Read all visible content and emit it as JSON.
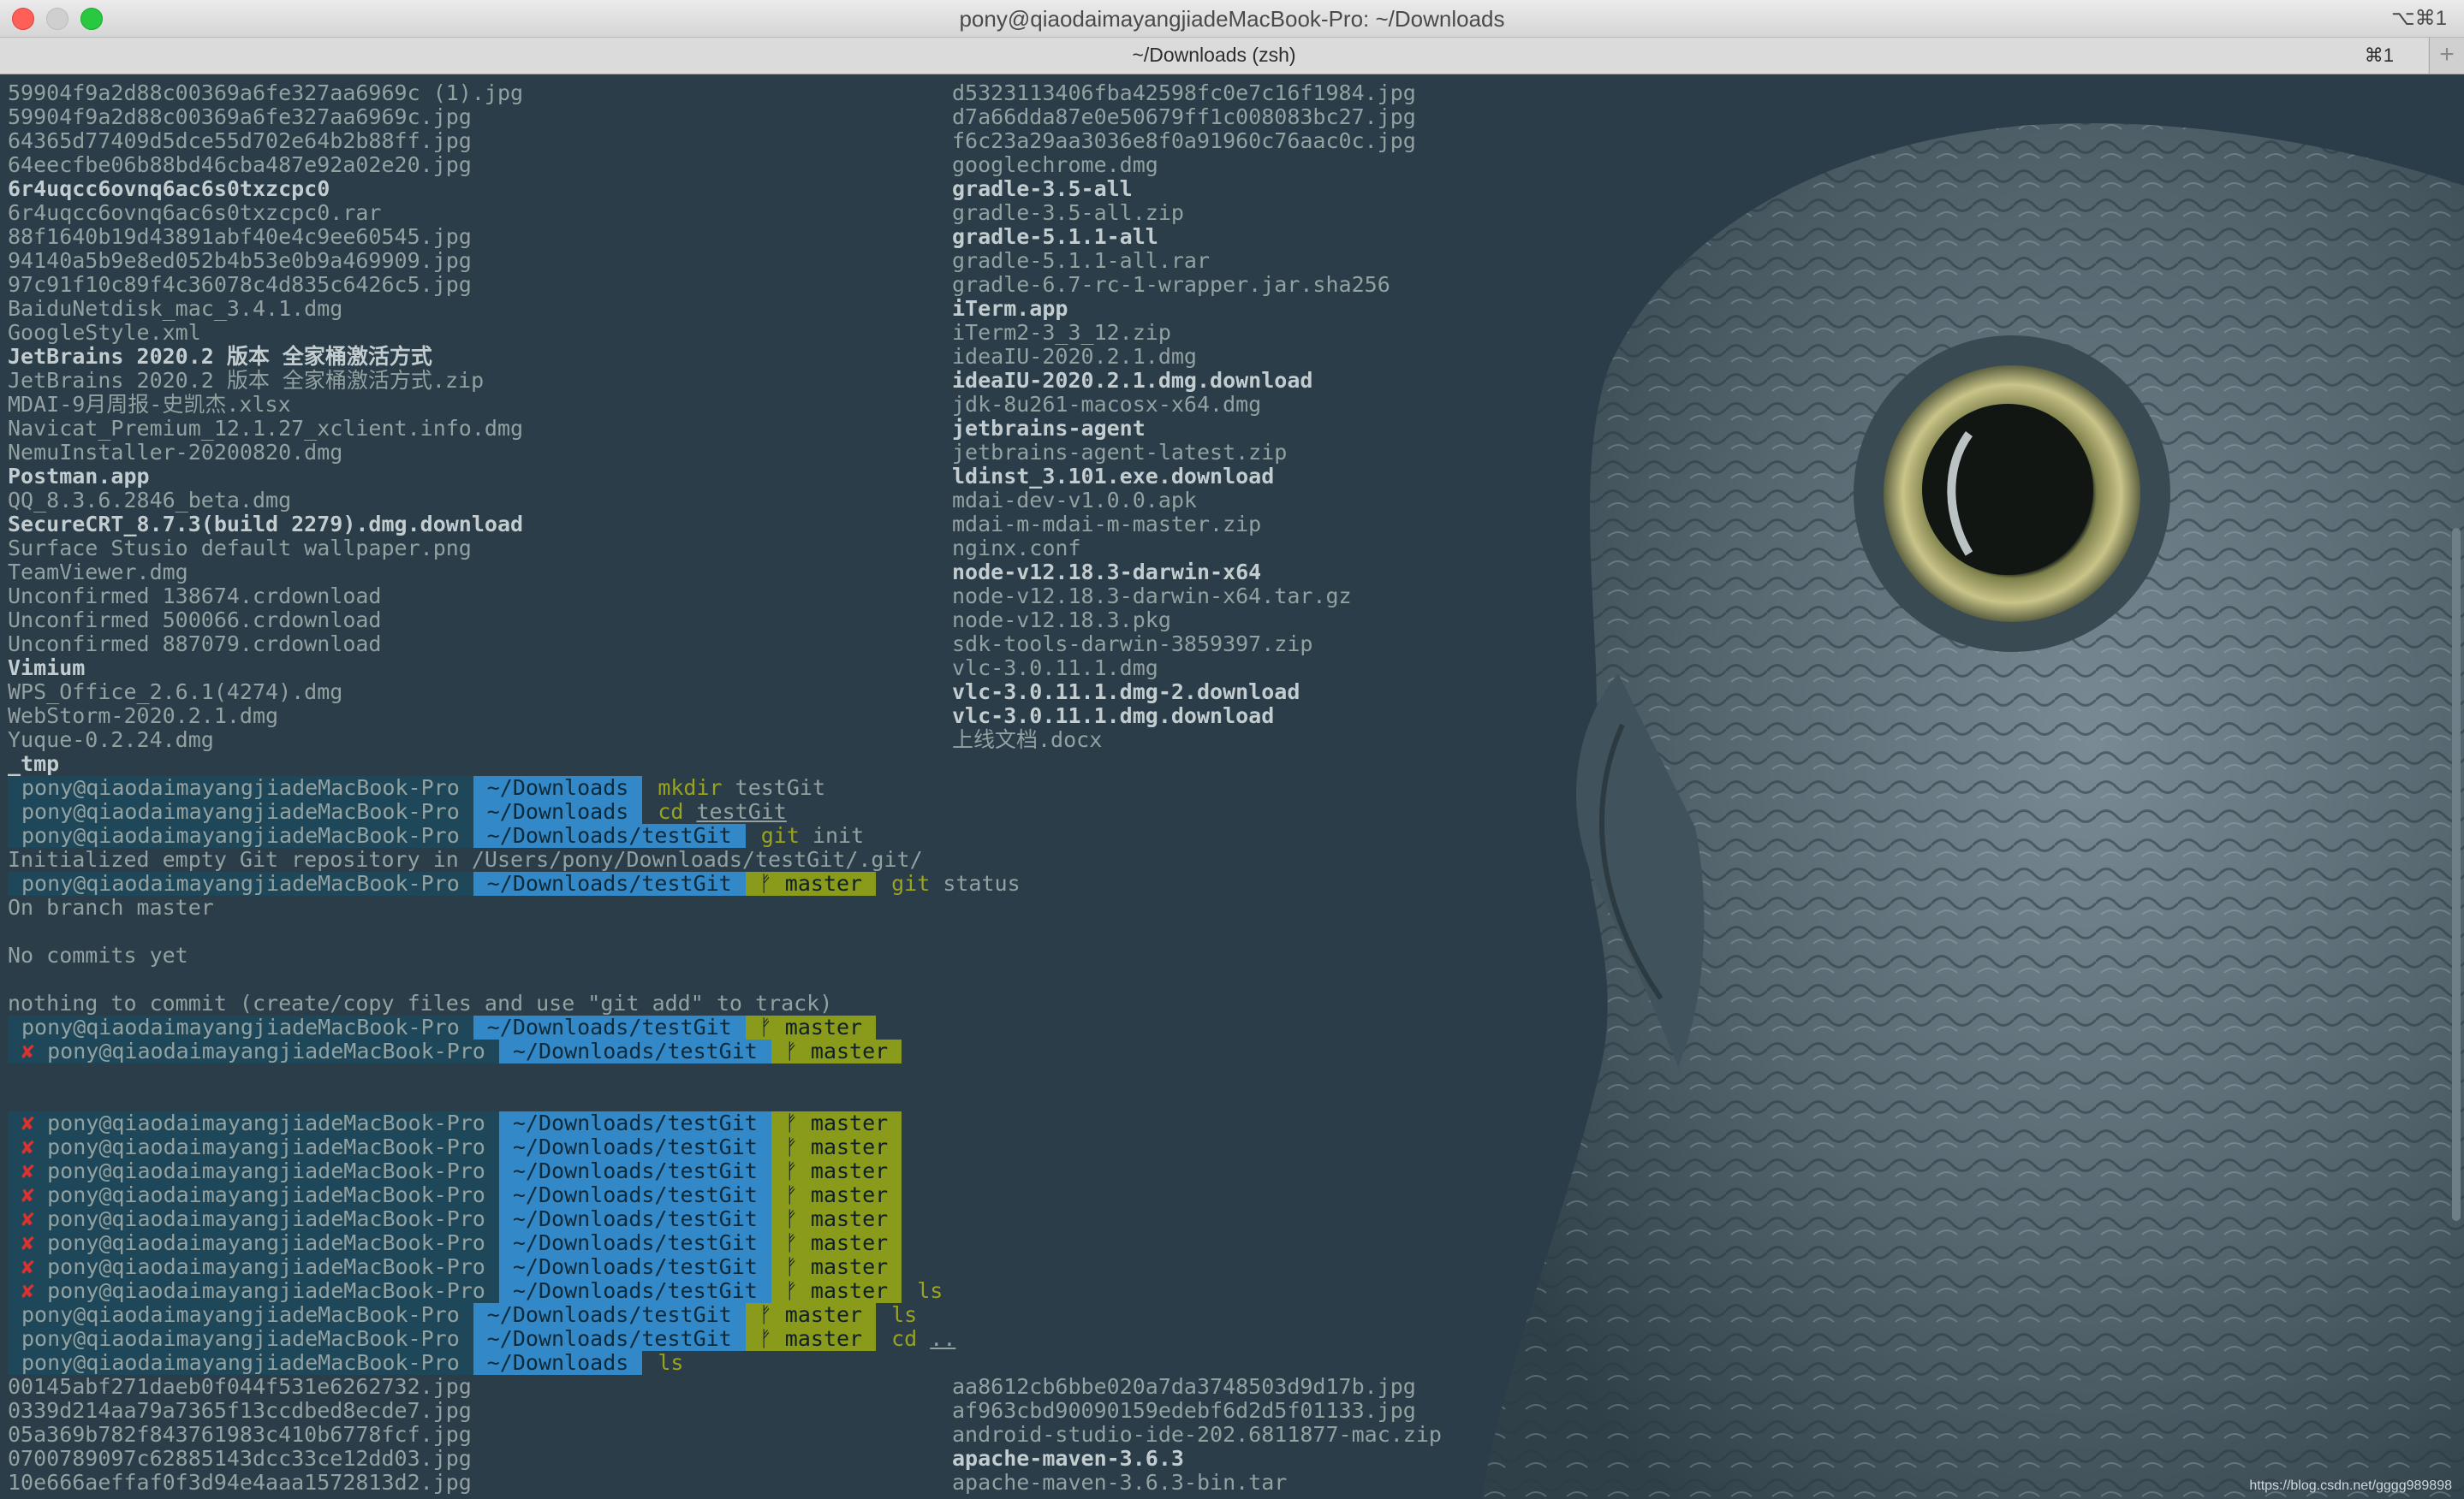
{
  "window": {
    "title": "pony@qiaodaimayangjiadeMacBook-Pro: ~/Downloads",
    "shortcut": "⌥⌘1",
    "tab_title": "~/Downloads (zsh)",
    "tab_shortcut": "⌘1",
    "new_tab": "+"
  },
  "theme": {
    "background": "#2a3d49",
    "text": "#93a1a1",
    "prompt_user_bg": "#1e4859",
    "prompt_dir_bg": "#3388c8",
    "prompt_git_bg": "#8a9a1a",
    "error_mark": "#dc322f"
  },
  "prompt": {
    "user": "pony@qiaodaimayangjiadeMacBook-Pro",
    "err_mark": "✘",
    "branch_icon": "ᚠ"
  },
  "terminal": {
    "listing1_col1": [
      "59904f9a2d88c00369a6fe327aa6969c (1).jpg",
      "59904f9a2d88c00369a6fe327aa6969c.jpg",
      "64365d77409d5dce55d702e64b2b88ff.jpg",
      "64eecfbe06b88bd46cba487e92a02e20.jpg",
      "6r4uqcc6ovnq6ac6s0txzcpc0",
      "6r4uqcc6ovnq6ac6s0txzcpc0.rar",
      "88f1640b19d43891abf40e4c9ee60545.jpg",
      "94140a5b9e8ed052b4b53e0b9a469909.jpg",
      "97c91f10c89f4c36078c4d835c6426c5.jpg",
      "BaiduNetdisk_mac_3.4.1.dmg",
      "GoogleStyle.xml",
      "JetBrains 2020.2 版本 全家桶激活方式",
      "JetBrains 2020.2 版本 全家桶激活方式.zip",
      "MDAI-9月周报-史凯杰.xlsx",
      "Navicat_Premium_12.1.27_xclient.info.dmg",
      "NemuInstaller-20200820.dmg",
      "Postman.app",
      "QQ_8.3.6.2846_beta.dmg",
      "SecureCRT_8.7.3(build 2279).dmg.download",
      "Surface Stusio default wallpaper.png",
      "TeamViewer.dmg",
      "Unconfirmed 138674.crdownload",
      "Unconfirmed 500066.crdownload",
      "Unconfirmed 887079.crdownload",
      "Vimium",
      "WPS_Office_2.6.1(4274).dmg",
      "WebStorm-2020.2.1.dmg",
      "Yuque-0.2.24.dmg",
      "_tmp"
    ],
    "listing1_col2": [
      "d5323113406fba42598fc0e7c16f1984.jpg",
      "d7a66dda87e0e50679ff1c008083bc27.jpg",
      "f6c23a29aa3036e8f0a91960c76aac0c.jpg",
      "googlechrome.dmg",
      "gradle-3.5-all",
      "gradle-3.5-all.zip",
      "gradle-5.1.1-all",
      "gradle-5.1.1-all.rar",
      "gradle-6.7-rc-1-wrapper.jar.sha256",
      "iTerm.app",
      "iTerm2-3_3_12.zip",
      "ideaIU-2020.2.1.dmg",
      "ideaIU-2020.2.1.dmg.download",
      "jdk-8u261-macosx-x64.dmg",
      "jetbrains-agent",
      "jetbrains-agent-latest.zip",
      "ldinst_3.101.exe.download",
      "mdai-dev-v1.0.0.apk",
      "mdai-m-mdai-m-master.zip",
      "nginx.conf",
      "node-v12.18.3-darwin-x64",
      "node-v12.18.3-darwin-x64.tar.gz",
      "node-v12.18.3.pkg",
      "sdk-tools-darwin-3859397.zip",
      "vlc-3.0.11.1.dmg",
      "vlc-3.0.11.1.dmg-2.download",
      "vlc-3.0.11.1.dmg.download",
      "上线文档.docx"
    ],
    "prompts": [
      {
        "err": false,
        "dir": "~/Downloads",
        "branch": "",
        "cmd": "mkdir",
        "arg": "testGit",
        "arg_under": false
      },
      {
        "err": false,
        "dir": "~/Downloads",
        "branch": "",
        "cmd": "cd",
        "arg": "testGit",
        "arg_under": true
      },
      {
        "err": false,
        "dir": "~/Downloads/testGit",
        "branch": "",
        "cmd": "git",
        "arg": "init",
        "arg_under": false
      },
      {
        "output": "Initialized empty Git repository in /Users/pony/Downloads/testGit/.git/"
      },
      {
        "err": false,
        "dir": "~/Downloads/testGit",
        "branch": "master",
        "cmd": "git",
        "arg": "status",
        "arg_under": false
      },
      {
        "output": "On branch master"
      },
      {
        "output": ""
      },
      {
        "output": "No commits yet"
      },
      {
        "output": ""
      },
      {
        "output": "nothing to commit (create/copy files and use \"git add\" to track)"
      },
      {
        "err": false,
        "dir": "~/Downloads/testGit",
        "branch": "master",
        "cmd": "",
        "arg": "",
        "arg_under": false
      },
      {
        "err": true,
        "dir": "~/Downloads/testGit",
        "branch": "master",
        "cmd": "",
        "arg": "",
        "arg_under": false
      },
      {
        "output": ""
      },
      {
        "output": ""
      },
      {
        "err": true,
        "dir": "~/Downloads/testGit",
        "branch": "master",
        "cmd": "",
        "arg": "",
        "arg_under": false
      },
      {
        "err": true,
        "dir": "~/Downloads/testGit",
        "branch": "master",
        "cmd": "",
        "arg": "",
        "arg_under": false
      },
      {
        "err": true,
        "dir": "~/Downloads/testGit",
        "branch": "master",
        "cmd": "",
        "arg": "",
        "arg_under": false
      },
      {
        "err": true,
        "dir": "~/Downloads/testGit",
        "branch": "master",
        "cmd": "",
        "arg": "",
        "arg_under": false
      },
      {
        "err": true,
        "dir": "~/Downloads/testGit",
        "branch": "master",
        "cmd": "",
        "arg": "",
        "arg_under": false
      },
      {
        "err": true,
        "dir": "~/Downloads/testGit",
        "branch": "master",
        "cmd": "",
        "arg": "",
        "arg_under": false
      },
      {
        "err": true,
        "dir": "~/Downloads/testGit",
        "branch": "master",
        "cmd": "",
        "arg": "",
        "arg_under": false
      },
      {
        "err": true,
        "dir": "~/Downloads/testGit",
        "branch": "master",
        "cmd": "ls",
        "arg": "",
        "arg_under": false
      },
      {
        "err": false,
        "dir": "~/Downloads/testGit",
        "branch": "master",
        "cmd": "ls",
        "arg": "",
        "arg_under": false
      },
      {
        "err": false,
        "dir": "~/Downloads/testGit",
        "branch": "master",
        "cmd": "cd",
        "arg": "..",
        "arg_under": true
      },
      {
        "err": false,
        "dir": "~/Downloads",
        "branch": "",
        "cmd": "ls",
        "arg": "",
        "arg_under": false
      }
    ],
    "listing2_col1": [
      "00145abf271daeb0f044f531e6262732.jpg",
      "0339d214aa79a7365f13ccdbed8ecde7.jpg",
      "05a369b782f843761983c410b6778fcf.jpg",
      "0700789097c62885143dcc33ce12dd03.jpg",
      "10e666aeffaf0f3d94e4aaa1572813d2.jpg"
    ],
    "listing2_col2": [
      "aa8612cb6bbe020a7da3748503d9d17b.jpg",
      "af963cbd90090159edebf6d2d5f01133.jpg",
      "android-studio-ide-202.6811877-mac.zip",
      "apache-maven-3.6.3",
      "apache-maven-3.6.3-bin.tar"
    ]
  },
  "watermark": "https://blog.csdn.net/gggg989898"
}
